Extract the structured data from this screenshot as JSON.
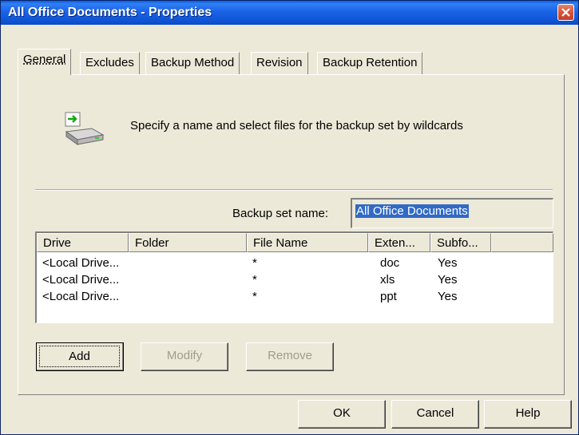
{
  "window": {
    "title": "All Office Documents - Properties"
  },
  "tabs": [
    {
      "label": "General"
    },
    {
      "label": "Excludes"
    },
    {
      "label": "Backup Method"
    },
    {
      "label": "Revision"
    },
    {
      "label": "Backup Retention"
    }
  ],
  "general": {
    "intro_text": "Specify a name and select files for the backup set by wildcards",
    "name_label": "Backup set name:",
    "name_value": "All Office Documents",
    "columns": [
      "Drive",
      "Folder",
      "File Name",
      "Exten...",
      "Subfo..."
    ],
    "rows": [
      [
        "<Local Drive...",
        "",
        "*",
        "doc",
        "Yes"
      ],
      [
        "<Local Drive...",
        "",
        "*",
        "xls",
        "Yes"
      ],
      [
        "<Local Drive...",
        "",
        "*",
        "ppt",
        "Yes"
      ]
    ],
    "add_label": "Add",
    "modify_label": "Modify",
    "remove_label": "Remove"
  },
  "footer": {
    "ok_label": "OK",
    "cancel_label": "Cancel",
    "help_label": "Help"
  },
  "icons": {
    "close": "close-icon",
    "intro": "backup-drive-icon"
  },
  "colors": {
    "titlebar": "#0f55d8",
    "selection": "#316ac5",
    "face": "#ece9d8"
  }
}
